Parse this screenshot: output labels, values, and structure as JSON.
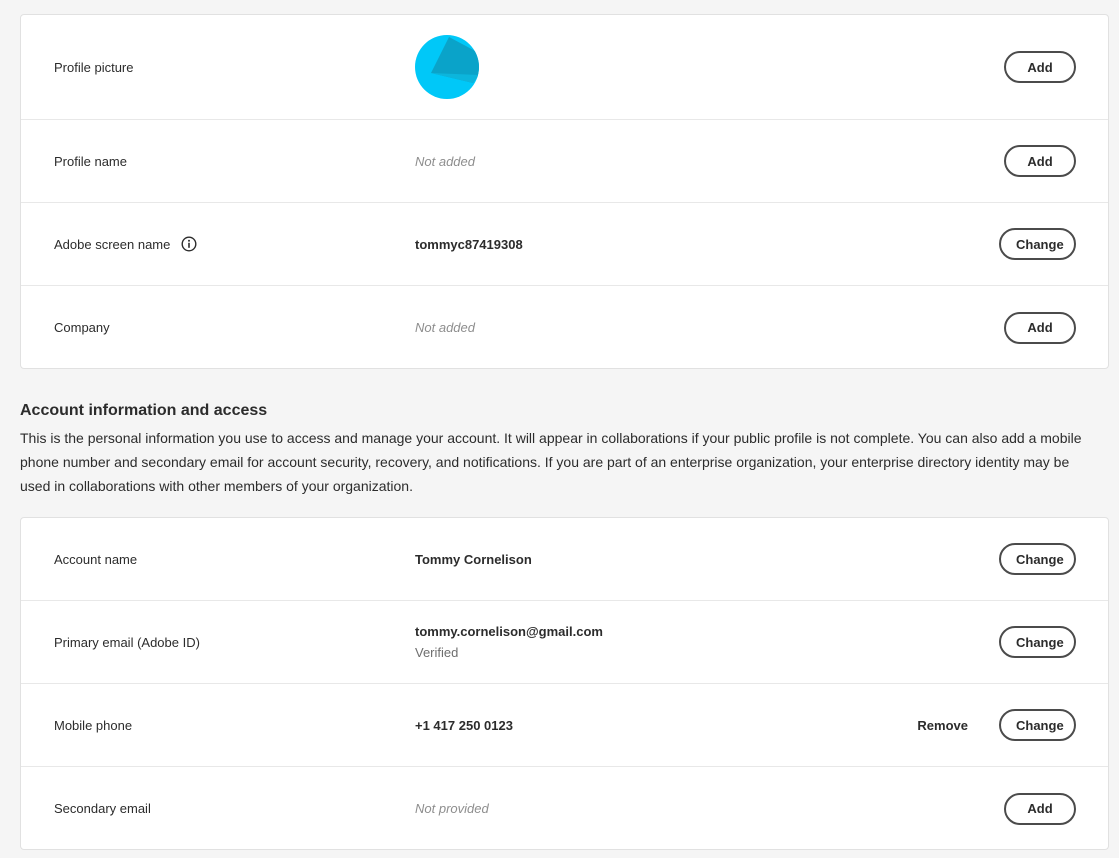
{
  "profile": {
    "rows": [
      {
        "label": "Profile picture",
        "button": "Add"
      },
      {
        "label": "Profile name",
        "value": "Not added",
        "button": "Add"
      },
      {
        "label": "Adobe screen name",
        "value": "tommyc87419308",
        "button": "Change"
      },
      {
        "label": "Company",
        "value": "Not added",
        "button": "Add"
      }
    ]
  },
  "account_section": {
    "title": "Account information and access",
    "description": "This is the personal information you use to access and manage your account. It will appear in collaborations if your public profile is not complete. You can also add a mobile phone number and secondary email for account security, recovery, and notifications. If you are part of an enterprise organization, your enterprise directory identity may be used in collaborations with other members of your organization."
  },
  "account": {
    "rows": [
      {
        "label": "Account name",
        "value": "Tommy Cornelison",
        "button": "Change"
      },
      {
        "label": "Primary email (Adobe ID)",
        "value": "tommy.cornelison@gmail.com",
        "status": "Verified",
        "button": "Change"
      },
      {
        "label": "Mobile phone",
        "value": "+1 417 250 0123",
        "secondary_button": "Remove",
        "button": "Change"
      },
      {
        "label": "Secondary email",
        "value": "Not provided",
        "button": "Add"
      }
    ]
  },
  "colors": {
    "avatar_primary": "#00c8f8",
    "avatar_shade": "#0aa3c9",
    "button_border": "#4b4b4b",
    "muted_text": "#8e8e8e"
  },
  "icons": {
    "info": "info-circle-icon"
  }
}
